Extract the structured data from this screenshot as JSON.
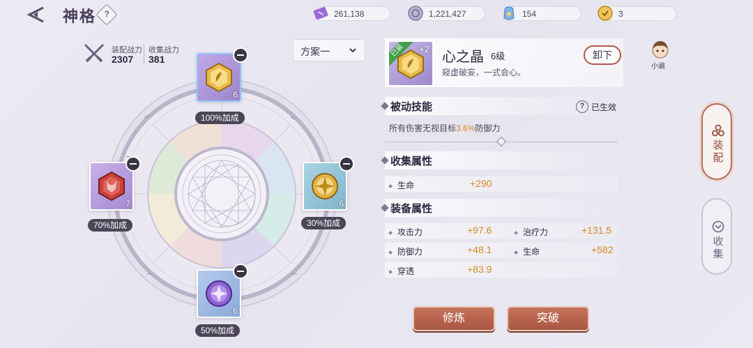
{
  "header": {
    "title": "神格",
    "help_label": "?"
  },
  "resources": [
    {
      "icon": "crystal-ticket-icon",
      "value": "261,138"
    },
    {
      "icon": "silver-coin-icon",
      "value": "1,221,427"
    },
    {
      "icon": "essence-jar-icon",
      "value": "154"
    },
    {
      "icon": "gold-medal-icon",
      "value": "3"
    }
  ],
  "power": {
    "equip_label": "装配战力",
    "equip_value": "2307",
    "collect_label": "收集战力",
    "collect_value": "381"
  },
  "plan": {
    "selected": "方案一"
  },
  "slots": [
    {
      "id": "top",
      "level": "6",
      "bonus": "100%加成",
      "gem": "golden-feather-gem",
      "bg": "#a48ccf"
    },
    {
      "id": "left",
      "level": "7",
      "bonus": "70%加成",
      "gem": "red-wolf-gem",
      "bg": "#b59ad9"
    },
    {
      "id": "right",
      "level": "6",
      "bonus": "30%加成",
      "gem": "golden-sun-gem",
      "bg": "#8fc2d6"
    },
    {
      "id": "bottom",
      "level": "6",
      "bonus": "50%加成",
      "gem": "purple-star-gem",
      "bg": "#9fb8e2"
    }
  ],
  "item": {
    "equipped_tag": "已装",
    "plus": "+2",
    "name": "心之晶",
    "level": "6级",
    "desc": "窥虚破妄，一式会心。",
    "unequip_label": "卸下"
  },
  "passive": {
    "title": "被动技能",
    "status": "已生效",
    "desc_prefix": "所有伤害无视目标",
    "desc_highlight": "3.6%",
    "desc_suffix": "防御力"
  },
  "collect_attrs": {
    "title": "收集属性",
    "items": [
      {
        "name": "生命",
        "value": "+290"
      }
    ]
  },
  "equip_attrs": {
    "title": "装备属性",
    "items": [
      {
        "name": "攻击力",
        "value": "+97.6"
      },
      {
        "name": "治疗力",
        "value": "+131.5"
      },
      {
        "name": "防御力",
        "value": "+48.1"
      },
      {
        "name": "生命",
        "value": "+582"
      },
      {
        "name": "穿透",
        "value": "+83.9"
      }
    ]
  },
  "actions": {
    "train_label": "修炼",
    "breakthrough_label": "突破"
  },
  "side": {
    "avatar_name": "小谕",
    "tab_equip": "装配",
    "tab_collect": "收集"
  },
  "colors": {
    "accent_orange": "#d48a20",
    "button_red": "#b4604b",
    "equipped_green": "#3fa14a"
  }
}
